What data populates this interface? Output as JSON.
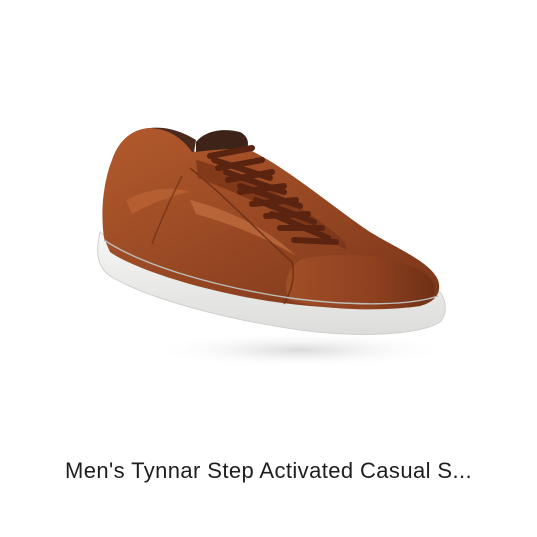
{
  "product": {
    "title": "Men's Tynnar Step Activated Casual S...",
    "image_icon": "sneaker-product-image",
    "colors": {
      "leather": "#9a4a24",
      "leather_dark": "#6e3118",
      "leather_highlight": "#c06b3e",
      "collar": "#4a2a1c",
      "sole": "#f2f2f0",
      "sole_shadow": "#d8d8d6",
      "shadow": "#e6e6e6",
      "text": "#1e1e1e",
      "background": "#ffffff"
    }
  }
}
